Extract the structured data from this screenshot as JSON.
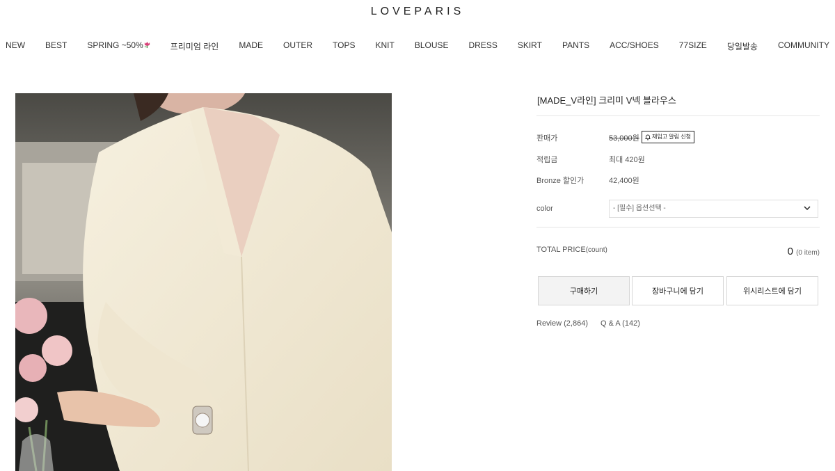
{
  "brand": {
    "logo": "LOVEPARIS"
  },
  "nav": {
    "items": [
      {
        "label": "NEW"
      },
      {
        "label": "BEST"
      },
      {
        "label": "SPRING ~50%",
        "icon": "tulip-icon"
      },
      {
        "label": "프리미엄 라인"
      },
      {
        "label": "MADE"
      },
      {
        "label": "OUTER"
      },
      {
        "label": "TOPS"
      },
      {
        "label": "KNIT"
      },
      {
        "label": "BLOUSE"
      },
      {
        "label": "DRESS"
      },
      {
        "label": "SKIRT"
      },
      {
        "label": "PANTS"
      },
      {
        "label": "ACC/SHOES"
      },
      {
        "label": "77SIZE"
      },
      {
        "label": "당일발송"
      },
      {
        "label": "COMMUNITY"
      }
    ]
  },
  "product": {
    "title": "[MADE_V라인] 크리미 V넥 블라우스",
    "price_label": "판매가",
    "price": "53,000원",
    "restock_label": "재입고 알림 신청",
    "points_label": "적립금",
    "points_value": "최대 420원",
    "member_price_label": "Bronze 할인가",
    "member_price_value": "42,400원",
    "color_label": "color",
    "color_select": "- [필수] 옵션선택 -",
    "total_label": "TOTAL PRICE",
    "total_sub": "(count)",
    "total_value": "0",
    "total_items": "(0 item)",
    "buy_label": "구매하기",
    "cart_label": "장바구니에 담기",
    "wish_label": "위시리스트에 담기",
    "review_label": "Review (2,864)",
    "qna_label": "Q & A (142)"
  },
  "colors": {
    "accent": "#222222",
    "rule": "#e5e5e5",
    "buy_bg": "#f3f3f3"
  }
}
